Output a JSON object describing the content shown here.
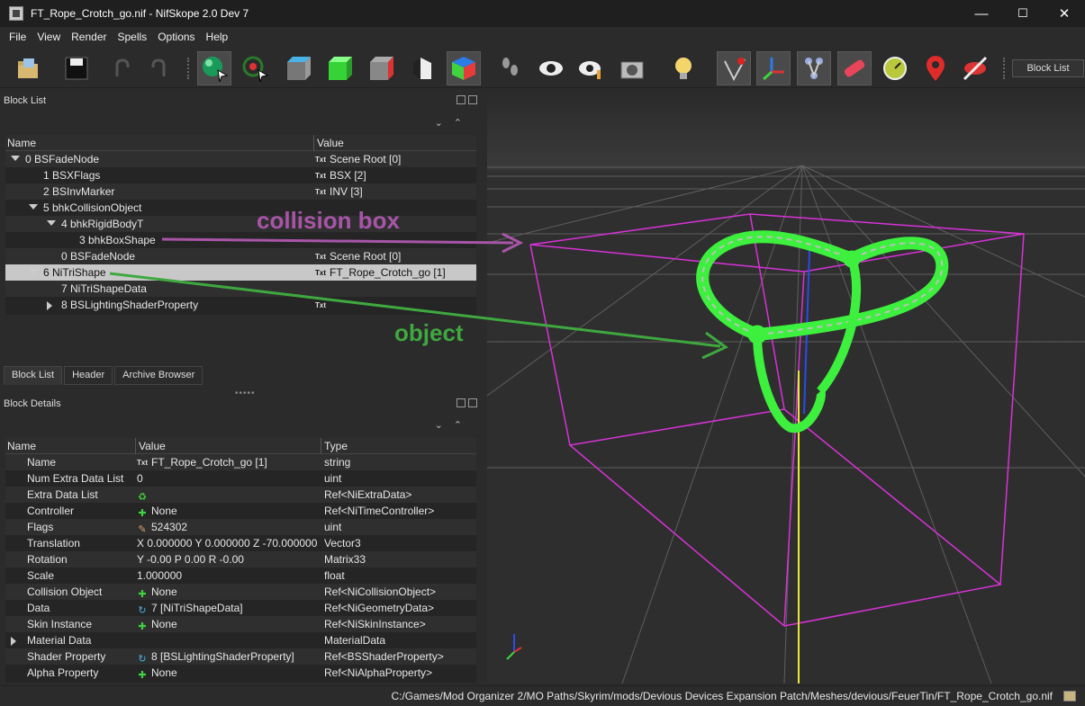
{
  "window": {
    "title": "FT_Rope_Crotch_go.nif - NifSkope 2.0 Dev 7",
    "minimize": "—",
    "maximize": "☐",
    "close": "✕"
  },
  "menu": [
    "File",
    "View",
    "Render",
    "Spells",
    "Options",
    "Help"
  ],
  "toolbar": {
    "block_list_label": "Block List"
  },
  "block_list": {
    "title": "Block List",
    "columns": [
      "Name",
      "Value"
    ],
    "rows": [
      {
        "name": "0 BSFadeNode",
        "value": "Scene Root [0]",
        "txt": "Txt",
        "caret": "down"
      },
      {
        "name": "1 BSXFlags",
        "value": "BSX [2]",
        "txt": "Txt",
        "caret": ""
      },
      {
        "name": "2 BSInvMarker",
        "value": "INV [3]",
        "txt": "Txt",
        "caret": ""
      },
      {
        "name": "5 bhkCollisionObject",
        "value": "",
        "txt": "",
        "caret": "down"
      },
      {
        "name": "4 bhkRigidBodyT",
        "value": "",
        "txt": "",
        "caret": "down"
      },
      {
        "name": "3 bhkBoxShape",
        "value": "",
        "txt": "",
        "caret": ""
      },
      {
        "name": "0 BSFadeNode",
        "value": "Scene Root [0]",
        "txt": "Txt",
        "caret": ""
      },
      {
        "name": "6 NiTriShape",
        "value": "FT_Rope_Crotch_go [1]",
        "txt": "Txt",
        "caret": "down"
      },
      {
        "name": "7 NiTriShapeData",
        "value": "",
        "txt": "",
        "caret": ""
      },
      {
        "name": "8 BSLightingShaderProperty",
        "value": "",
        "txt": "Txt",
        "caret": "right"
      }
    ]
  },
  "tabs": [
    "Block List",
    "Header",
    "Archive Browser"
  ],
  "block_details": {
    "title": "Block Details",
    "columns": [
      "Name",
      "Value",
      "Type"
    ],
    "rows": [
      {
        "name": "Name",
        "value": "FT_Rope_Crotch_go [1]",
        "type": "string",
        "icon": "Txt"
      },
      {
        "name": "Num Extra Data List",
        "value": "0",
        "type": "uint",
        "icon": ""
      },
      {
        "name": "Extra Data List",
        "value": "",
        "type": "Ref<NiExtraData>",
        "icon": "♻"
      },
      {
        "name": "Controller",
        "value": "None",
        "type": "Ref<NiTimeController>",
        "icon": "✚"
      },
      {
        "name": "Flags",
        "value": "524302",
        "type": "uint",
        "icon": "✎"
      },
      {
        "name": "Translation",
        "value": "X 0.000000 Y 0.000000 Z -70.000000",
        "type": "Vector3",
        "icon": ""
      },
      {
        "name": "Rotation",
        "value": "Y -0.00 P 0.00 R -0.00",
        "type": "Matrix33",
        "icon": ""
      },
      {
        "name": "Scale",
        "value": "1.000000",
        "type": "float",
        "icon": ""
      },
      {
        "name": "Collision Object",
        "value": "None",
        "type": "Ref<NiCollisionObject>",
        "icon": "✚"
      },
      {
        "name": "Data",
        "value": "7 [NiTriShapeData]",
        "type": "Ref<NiGeometryData>",
        "icon": "↻"
      },
      {
        "name": "Skin Instance",
        "value": "None",
        "type": "Ref<NiSkinInstance>",
        "icon": "✚"
      },
      {
        "name": "Material Data",
        "value": "",
        "type": "MaterialData",
        "icon": ""
      },
      {
        "name": "Shader Property",
        "value": "8 [BSLightingShaderProperty]",
        "type": "Ref<BSShaderProperty>",
        "icon": "↻"
      },
      {
        "name": "Alpha Property",
        "value": "None",
        "type": "Ref<NiAlphaProperty>",
        "icon": "✚"
      }
    ]
  },
  "annotations": {
    "collision": "collision box",
    "object": "object",
    "collision_color": "#a855a8",
    "object_color": "#3fa83f"
  },
  "status": {
    "path": "C:/Games/Mod Organizer 2/MO Paths/Skyrim/mods/Devious Devices Expansion Patch/Meshes/devious/FeuerTin/FT_Rope_Crotch_go.nif"
  }
}
